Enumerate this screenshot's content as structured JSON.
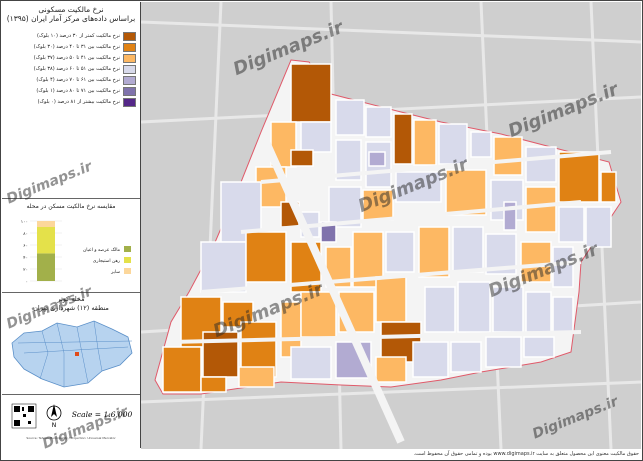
{
  "title": {
    "line1": "نرخ مالکیت مسکونی",
    "line2": "براساس داده‌های مرکز آمار ایران (۱۳۹۵)"
  },
  "legend": [
    {
      "label": "نرخ مالکیت کمتر از ۳۰ درصد (۱۰ بلوک)",
      "color": "#b35806"
    },
    {
      "label": "نرخ مالکیت بین ۳۱ تا ۴۰ درصد (۳۰ بلوک)",
      "color": "#e08214"
    },
    {
      "label": "نرخ مالکیت بین ۴۱ تا ۵۰ درصد (۳۷ بلوک)",
      "color": "#fdb863"
    },
    {
      "label": "نرخ مالکیت بین ۵۱ تا ۶۰ درصد (۳۸ بلوک)",
      "color": "#d8daeb"
    },
    {
      "label": "نرخ مالکیت بین ۶۱ تا ۷۰ درصد (۴ بلوک)",
      "color": "#b2abd2"
    },
    {
      "label": "نرخ مالکیت بین ۷۱ تا ۸۰ درصد (۱ بلوک)",
      "color": "#8073ac"
    },
    {
      "label": "نرخ مالکیت بیشتر از ۸۱ درصد (۰ بلوک)",
      "color": "#542788"
    }
  ],
  "chart_data": {
    "type": "bar",
    "title": "مقایسه نرخ مالکیت مسکن در محله",
    "categories": [
      "محله"
    ],
    "ticks": [
      "۱۰۰",
      "۸۰",
      "۶۰",
      "۴۰",
      "۲۰",
      "۰"
    ],
    "ylim": [
      0,
      100
    ],
    "series": [
      {
        "name": "مالک عرصه و اعیان",
        "values": [
          46
        ],
        "color": "#a2b04a"
      },
      {
        "name": "رهن استیجاری",
        "values": [
          44
        ],
        "color": "#e4e14a"
      },
      {
        "name": "سایر",
        "values": [
          10
        ],
        "color": "#fcd79b"
      }
    ]
  },
  "locator": {
    "title1": "محله کوثر",
    "title2": "منطقه (۱۲) شهرداری تهران"
  },
  "scale": {
    "text": "Scale = 1:6,000",
    "north": "N",
    "credit": "Source: Tehran Municipality / Projection: Universal Mercator"
  },
  "watermark": "Digimaps.ir",
  "footer": "حقوق مالکیت معنوی این محصول متعلق به سایت www.digimaps.ir بوده و تمامی حقوق آن محفوظ است."
}
